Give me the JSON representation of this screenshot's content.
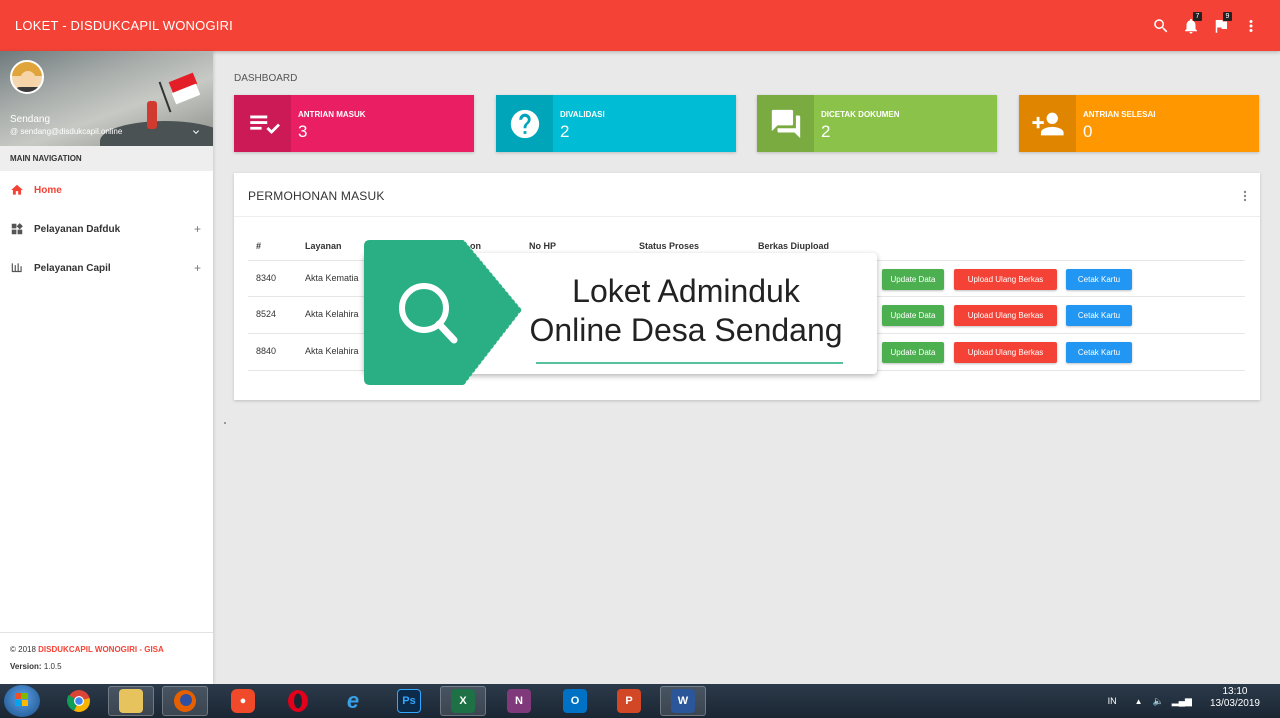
{
  "header": {
    "brand": "LOKET - DISDUKCAPIL WONOGIRI",
    "notif_count": "7",
    "flag_count": "9"
  },
  "sidebar": {
    "user_name": "Sendang",
    "user_email": "@ sendang@disdukcapil.online",
    "nav_header": "MAIN NAVIGATION",
    "items": [
      {
        "label": "Home",
        "icon": "home-icon",
        "active": true
      },
      {
        "label": "Pelayanan Dafduk",
        "icon": "widgets-icon",
        "expandable": "+"
      },
      {
        "label": "Pelayanan Capil",
        "icon": "timeline-icon",
        "expandable": "+"
      }
    ],
    "footer": {
      "copyright": "© 2018",
      "brand": "DISDUKCAPIL WONOGIRI - GISA",
      "version_label": "Version:",
      "version": "1.0.5"
    }
  },
  "main": {
    "breadcrumb": "DASHBOARD",
    "info_boxes": [
      {
        "label": "ANTRIAN MASUK",
        "value": "3",
        "color": "#e91e63",
        "icon": "playlist-check-icon"
      },
      {
        "label": "DIVALIDASI",
        "value": "2",
        "color": "#00bcd4",
        "icon": "help-icon"
      },
      {
        "label": "DICETAK DOKUMEN",
        "value": "2",
        "color": "#8bc34a",
        "icon": "forum-icon"
      },
      {
        "label": "ANTRIAN SELESAI",
        "value": "0",
        "color": "#ff9800",
        "icon": "person-add-icon"
      }
    ],
    "table_card": {
      "title": "PERMOHONAN MASUK",
      "headers": [
        "#",
        "Layanan",
        "on",
        "No HP",
        "Status Proses",
        "Berkas Diupload"
      ],
      "rows": [
        {
          "id": "8340",
          "layanan": "Akta Kematia"
        },
        {
          "id": "8524",
          "layanan": "Akta Kelahira"
        },
        {
          "id": "8840",
          "layanan": "Akta Kelahira"
        }
      ],
      "actions": {
        "update": "Update Data",
        "upload": "Upload Ulang Berkas",
        "print": "Cetak Kartu"
      }
    }
  },
  "overlay": {
    "line1": "Loket Adminduk",
    "line2": "Online Desa Sendang",
    "accent": "#2db386"
  },
  "taskbar": {
    "apps": [
      "chrome-icon",
      "file-explorer-icon",
      "firefox-icon",
      "photo-app-icon",
      "opera-icon",
      "internet-explorer-icon",
      "photoshop-icon",
      "excel-icon",
      "onenote-icon",
      "outlook-icon",
      "powerpoint-icon",
      "word-icon"
    ],
    "photoshop": "Ps",
    "excel": "X",
    "onenote": "N",
    "outlook": "O",
    "powerpoint": "P",
    "word": "W",
    "lang": "IN",
    "time": "13:10",
    "date": "13/03/2019"
  }
}
